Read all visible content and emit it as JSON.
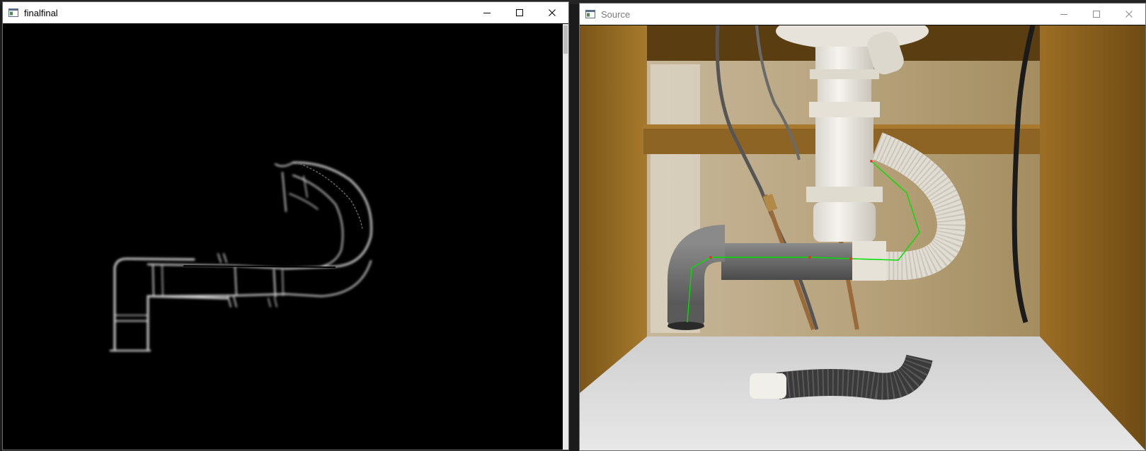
{
  "windows": {
    "left": {
      "title": "finalfinal",
      "content": "edge-detection-output"
    },
    "right": {
      "title": "Source",
      "content": "sink-drain-photo-with-traced-path"
    }
  },
  "controls": {
    "minimize": "minimize-icon",
    "maximize": "maximize-icon",
    "close": "close-icon"
  },
  "colors": {
    "titlebar_bg": "#ffffff",
    "title_active": "#000000",
    "title_inactive": "#7a7a7a",
    "trace_line": "#00e000",
    "trace_points": "#ff2020"
  }
}
